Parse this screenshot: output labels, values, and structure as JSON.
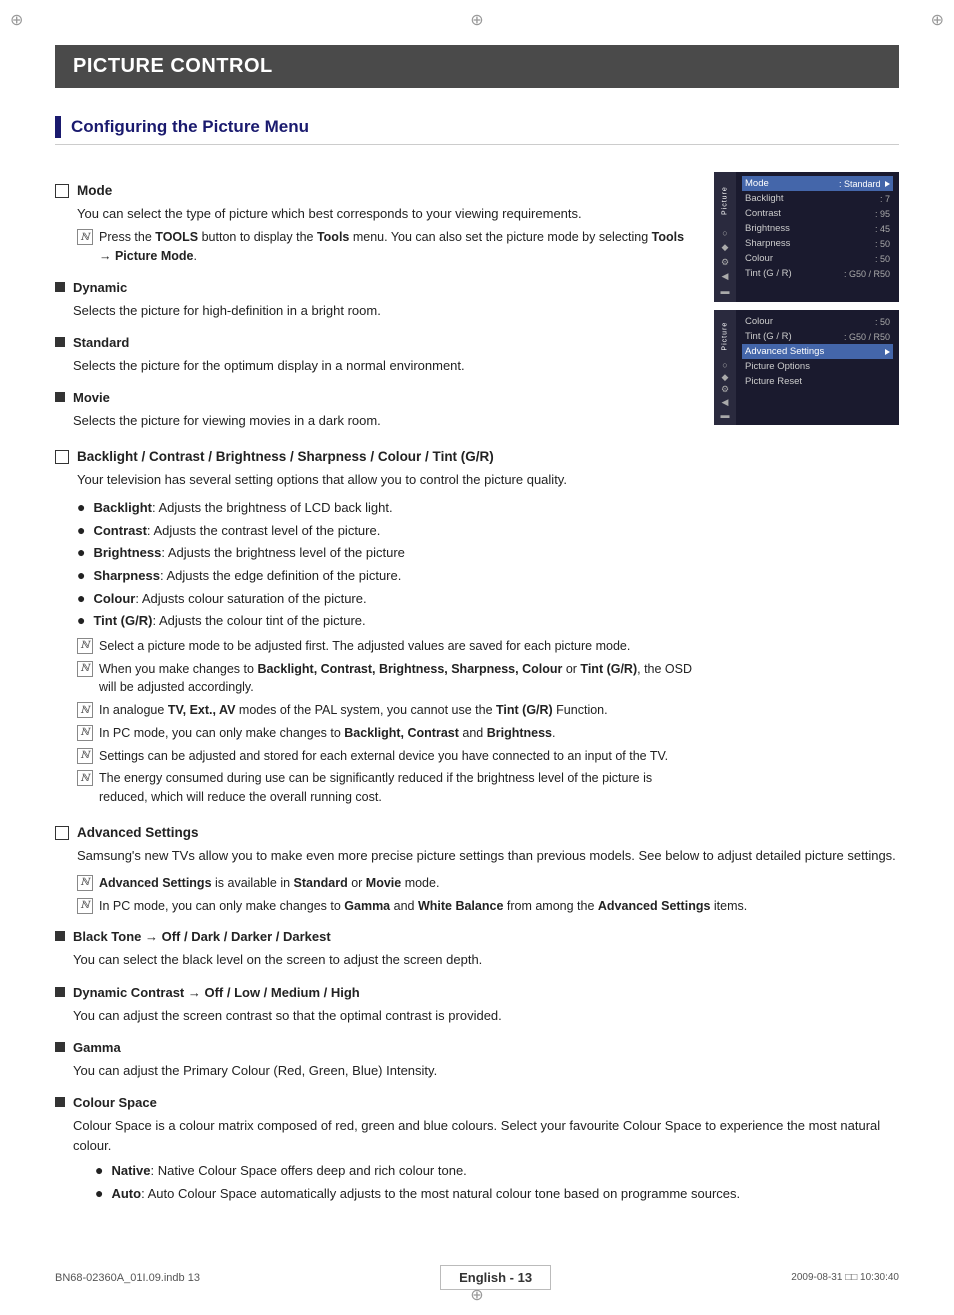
{
  "page": {
    "title": "PICTURE CONTROL",
    "section_heading": "Configuring the Picture Menu",
    "footer_center": "English - 13",
    "footer_left": "BN68-02360A_01I.09.indb   13",
    "footer_right": "2009-08-31   □□ 10:30:40"
  },
  "mode_section": {
    "title": "Mode",
    "body": "You can select the type of picture which best corresponds to your viewing requirements.",
    "note": "Press the TOOLS button to display the Tools menu. You can also set the picture mode by selecting Tools → Picture Mode.",
    "items": [
      {
        "label": "Dynamic",
        "desc": "Selects the picture for high-definition in a bright room."
      },
      {
        "label": "Standard",
        "desc": "Selects the picture for the optimum display in a normal environment."
      },
      {
        "label": "Movie",
        "desc": "Selects the picture for viewing movies in a dark room."
      }
    ]
  },
  "backlight_section": {
    "title": "Backlight / Contrast / Brightness / Sharpness / Colour / Tint (G/R)",
    "body": "Your television has several setting options that allow you to control the picture quality.",
    "bullets": [
      {
        "label": "Backlight",
        "desc": "Adjusts the brightness of LCD back light."
      },
      {
        "label": "Contrast",
        "desc": "Adjusts the contrast level of the picture."
      },
      {
        "label": "Brightness",
        "desc": "Adjusts the brightness level of the picture"
      },
      {
        "label": "Sharpness",
        "desc": "Adjusts the edge definition of the picture."
      },
      {
        "label": "Colour",
        "desc": "Adjusts colour saturation of the picture."
      },
      {
        "label": "Tint (G/R)",
        "desc": "Adjusts the colour tint of the picture."
      }
    ],
    "notes": [
      "Select a picture mode to be adjusted first. The adjusted values are saved for each picture mode.",
      "When you make changes to Backlight, Contrast, Brightness, Sharpness, Colour or Tint (G/R), the OSD will be adjusted accordingly.",
      "In analogue TV, Ext., AV modes of the PAL system, you cannot use the Tint (G/R) Function.",
      "In PC mode, you can only make changes to Backlight, Contrast and Brightness.",
      "Settings can be adjusted and stored for each external device you have connected to an input of the TV.",
      "The energy consumed during use can be significantly reduced if the brightness level of the picture is reduced, which will reduce the overall running cost."
    ]
  },
  "advanced_section": {
    "title": "Advanced Settings",
    "body": "Samsung's new TVs allow you to make even more precise picture settings than previous models. See below to adjust detailed picture settings.",
    "notes": [
      "Advanced Settings is available in Standard or Movie mode.",
      "In PC mode, you can only make changes to Gamma and White Balance from among the Advanced Settings items."
    ],
    "sub_items": [
      {
        "label": "Black Tone → Off / Dark / Darker / Darkest",
        "desc": "You can select the black level on the screen to adjust the screen depth."
      },
      {
        "label": "Dynamic Contrast → Off / Low / Medium / High",
        "desc": "You can adjust the screen contrast so that the optimal contrast is provided."
      },
      {
        "label": "Gamma",
        "desc": "You can adjust the Primary Colour (Red, Green, Blue) Intensity."
      },
      {
        "label": "Colour Space",
        "desc": "Colour Space is a colour matrix composed of red, green and blue colours. Select your favourite Colour Space to experience the most natural colour.",
        "bullets": [
          {
            "label": "Native",
            "desc": "Native Colour Space offers deep and rich colour tone."
          },
          {
            "label": "Auto",
            "desc": "Auto Colour Space automatically adjusts to the most natural colour tone based on programme sources."
          }
        ]
      }
    ]
  },
  "tv_screen1": {
    "label": "Picture",
    "highlighted_row": "Mode",
    "highlighted_value": "Standard",
    "rows": [
      {
        "label": "Backlight",
        "value": ": 7"
      },
      {
        "label": "Contrast",
        "value": ": 95"
      },
      {
        "label": "Brightness",
        "value": ": 45"
      },
      {
        "label": "Sharpness",
        "value": ": 50"
      },
      {
        "label": "Colour",
        "value": ": 50"
      },
      {
        "label": "Tint (G / R)",
        "value": ": G50 / R50"
      }
    ],
    "sidebar_icons": [
      "▶",
      "○",
      "◆",
      "⚙",
      "◀",
      "▬"
    ]
  },
  "tv_screen2": {
    "label": "Picture",
    "top_rows": [
      {
        "label": "Colour",
        "value": ": 50"
      },
      {
        "label": "Tint (G / R)",
        "value": ": G50 / R50"
      }
    ],
    "highlighted_row": "Advanced Settings",
    "rows": [
      {
        "label": "Picture Options",
        "value": ""
      },
      {
        "label": "Picture Reset",
        "value": ""
      }
    ],
    "sidebar_icons": [
      "▶",
      "○",
      "◆",
      "⚙",
      "◀",
      "▬"
    ]
  }
}
